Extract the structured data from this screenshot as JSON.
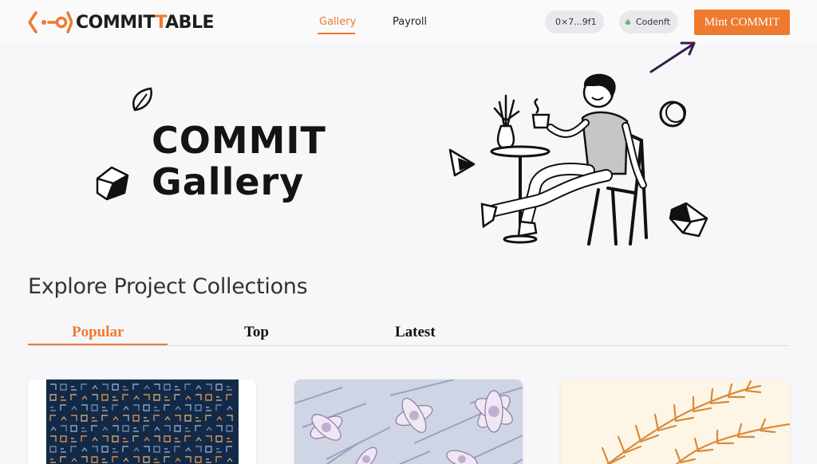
{
  "brand": {
    "name_part1": "COMMIT",
    "name_part2": "T",
    "name_part3": "ABLE",
    "accent_color": "#ee7a2f"
  },
  "nav": {
    "items": [
      {
        "label": "Gallery",
        "active": true
      },
      {
        "label": "Payroll",
        "active": false
      }
    ]
  },
  "header": {
    "wallet_address": "0×7...9f1",
    "wallet_icon": "wallet-icon",
    "user_name": "Codenft",
    "user_icon": "android-icon",
    "mint_button": "Mint COMMIT"
  },
  "hero": {
    "title_line1": "COMMIT",
    "title_line2": "Gallery"
  },
  "explore": {
    "title": "Explore Project Collections",
    "tabs": [
      {
        "label": "Popular",
        "active": true
      },
      {
        "label": "Top",
        "active": false
      },
      {
        "label": "Latest",
        "active": false
      }
    ]
  },
  "cards": [
    {
      "icon": "geometric-pattern-artwork"
    },
    {
      "icon": "floral-pattern-artwork"
    },
    {
      "icon": "fern-artwork"
    }
  ]
}
